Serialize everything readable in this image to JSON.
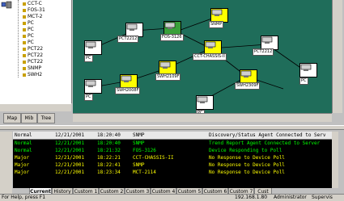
{
  "tree": {
    "items": [
      {
        "label": "CCT-C",
        "color": "#c8a000"
      },
      {
        "label": "FOS-31",
        "color": "#c8a000"
      },
      {
        "label": "MCT-2",
        "color": "#c8a000"
      },
      {
        "label": "PC",
        "color": "#c8a000"
      },
      {
        "label": "PC",
        "color": "#c8a000"
      },
      {
        "label": "PC",
        "color": "#c8a000"
      },
      {
        "label": "PC",
        "color": "#c8a000"
      },
      {
        "label": "PCT22",
        "color": "#c8a000"
      },
      {
        "label": "PCT22",
        "color": "#c8a000"
      },
      {
        "label": "PCT22",
        "color": "#c8a000"
      },
      {
        "label": "SNMP",
        "color": "#c8a000"
      },
      {
        "label": "SWH2",
        "color": "#c8a000"
      }
    ]
  },
  "tabs": {
    "map": "Map",
    "mib": "Mib",
    "tree": "Tree"
  },
  "map": {
    "nodes": [
      {
        "label": "PC",
        "icon": "pc-icon",
        "fill": "#ffffff"
      },
      {
        "label": "PCT2212",
        "icon": "router-icon",
        "fill": "#ffffff"
      },
      {
        "label": "FOS-3126",
        "icon": "switch-icon",
        "fill": "#3aa03a"
      },
      {
        "label": "SNMP",
        "icon": "monitor-icon",
        "fill": "#ffff00"
      },
      {
        "label": "CCT-CHASSIS-II",
        "icon": "chassis-icon",
        "fill": "#ffff00"
      },
      {
        "label": "PCT2212",
        "icon": "router-icon",
        "fill": "#ffffff"
      },
      {
        "label": "PC",
        "icon": "pc-icon",
        "fill": "#ffffff"
      },
      {
        "label": "SWH2109F",
        "icon": "switch-icon",
        "fill": "#ffff00"
      },
      {
        "label": "SWH2008F",
        "icon": "switch-icon",
        "fill": "#ffff00"
      },
      {
        "label": "SWH2309F",
        "icon": "switch-icon",
        "fill": "#ffff00"
      },
      {
        "label": "PC",
        "icon": "pc-icon",
        "fill": "#ffffff"
      },
      {
        "label": "PC",
        "icon": "pc-icon",
        "fill": "#ffffff"
      }
    ]
  },
  "log": {
    "headers": {
      "severity": "Normal",
      "date": "12/21/2001",
      "time": "18:20:40",
      "source": "SNMP",
      "message": "Discovery/Status Agent Connected to Serv"
    },
    "rows": [
      {
        "severity": "Normal",
        "date": "12/21/2001",
        "time": "18:20:40",
        "source": "SNMP",
        "message": "Trend Report Agent Connected to Server",
        "color": "#00ff00"
      },
      {
        "severity": "Normal",
        "date": "12/21/2001",
        "time": "18:21:32",
        "source": "FOS-3126",
        "message": "Device Responding to Poll",
        "color": "#00ff00"
      },
      {
        "severity": "Major",
        "date": "12/21/2001",
        "time": "18:22:21",
        "source": "CCT-CHASSIS-II",
        "message": "No Response to Device Poll",
        "color": "#ffff00"
      },
      {
        "severity": "Major",
        "date": "12/21/2001",
        "time": "18:22:41",
        "source": "SNMP",
        "message": "No Response to Device Poll",
        "color": "#ffff00"
      },
      {
        "severity": "Major",
        "date": "12/21/2001",
        "time": "18:23:34",
        "source": "MCT-2114",
        "message": "No Response to Device Poll",
        "color": "#ffff00"
      }
    ],
    "tabs": [
      "Current",
      "History",
      "Custom 1",
      "Custom 2",
      "Custom 3",
      "Custom 4",
      "Custom 5",
      "Custom 6",
      "Custom 7",
      "Cust"
    ]
  },
  "status": {
    "help": "For Help, press F1",
    "ip": "192.168.1.80",
    "user": "Administrator",
    "mode": "Supervis"
  }
}
